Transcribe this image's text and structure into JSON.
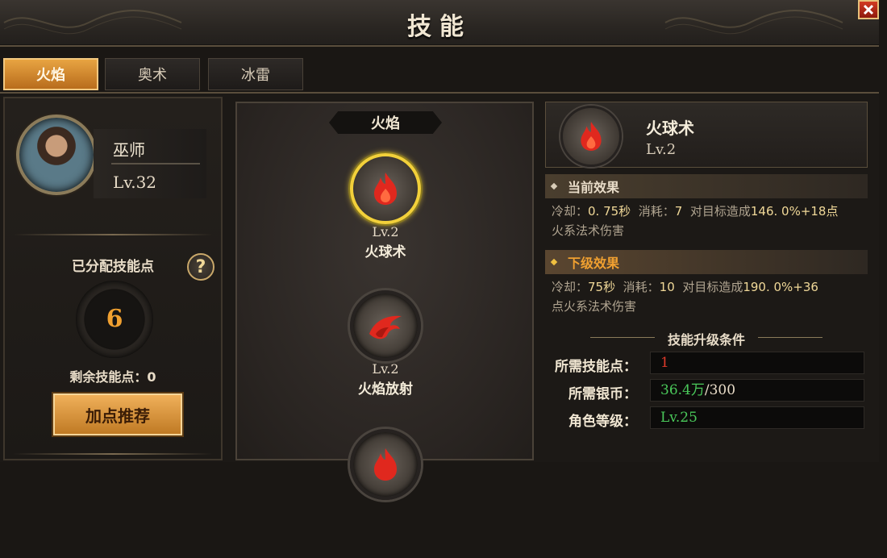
{
  "window": {
    "title": "技能"
  },
  "tabs": [
    {
      "label": "火焰",
      "active": true
    },
    {
      "label": "奥术",
      "active": false
    },
    {
      "label": "冰雷",
      "active": false
    }
  ],
  "character": {
    "class_name": "巫师",
    "level": "Lv.32"
  },
  "points": {
    "allocated_label": "已分配技能点",
    "allocated_value": "6",
    "remaining_label": "剩余技能点：0",
    "recommend_label": "加点推荐",
    "help_symbol": "?"
  },
  "skill_tree": {
    "branch_label": "火焰",
    "skills": [
      {
        "level": "Lv.2",
        "name": "火球术",
        "icon": "fireball-icon",
        "selected": true
      },
      {
        "level": "Lv.2",
        "name": "火焰放射",
        "icon": "flame-spray-icon",
        "selected": false
      }
    ]
  },
  "detail": {
    "name": "火球术",
    "level": "Lv.2",
    "current_effect": {
      "title": "当前效果",
      "cooldown_label": "冷却：",
      "cooldown_value": "0. 75秒",
      "cost_label": "消耗：",
      "cost_value": "7",
      "damage_prefix": "对目标造成",
      "damage_value": "146. 0%+18点",
      "damage_suffix": "火系法术伤害"
    },
    "next_effect": {
      "title": "下级效果",
      "cooldown_label": "冷却：",
      "cooldown_value": "75秒",
      "cost_label": "消耗：",
      "cost_value": "10",
      "damage_prefix": "对目标造成",
      "damage_value": "190. 0%+36",
      "damage_suffix": "点火系法术伤害"
    },
    "upgrade": {
      "title": "技能升级条件",
      "rows": [
        {
          "label": "所需技能点：",
          "value": "1"
        },
        {
          "label": "所需银币：",
          "value_have": "36.4万",
          "value_need": "/300"
        },
        {
          "label": "角色等级：",
          "value": "Lv.25"
        }
      ]
    }
  },
  "colors": {
    "accent": "#e8a442",
    "fire": "#e0281e",
    "insufficient": "#e03a2a",
    "sufficient": "#4ac85a"
  }
}
